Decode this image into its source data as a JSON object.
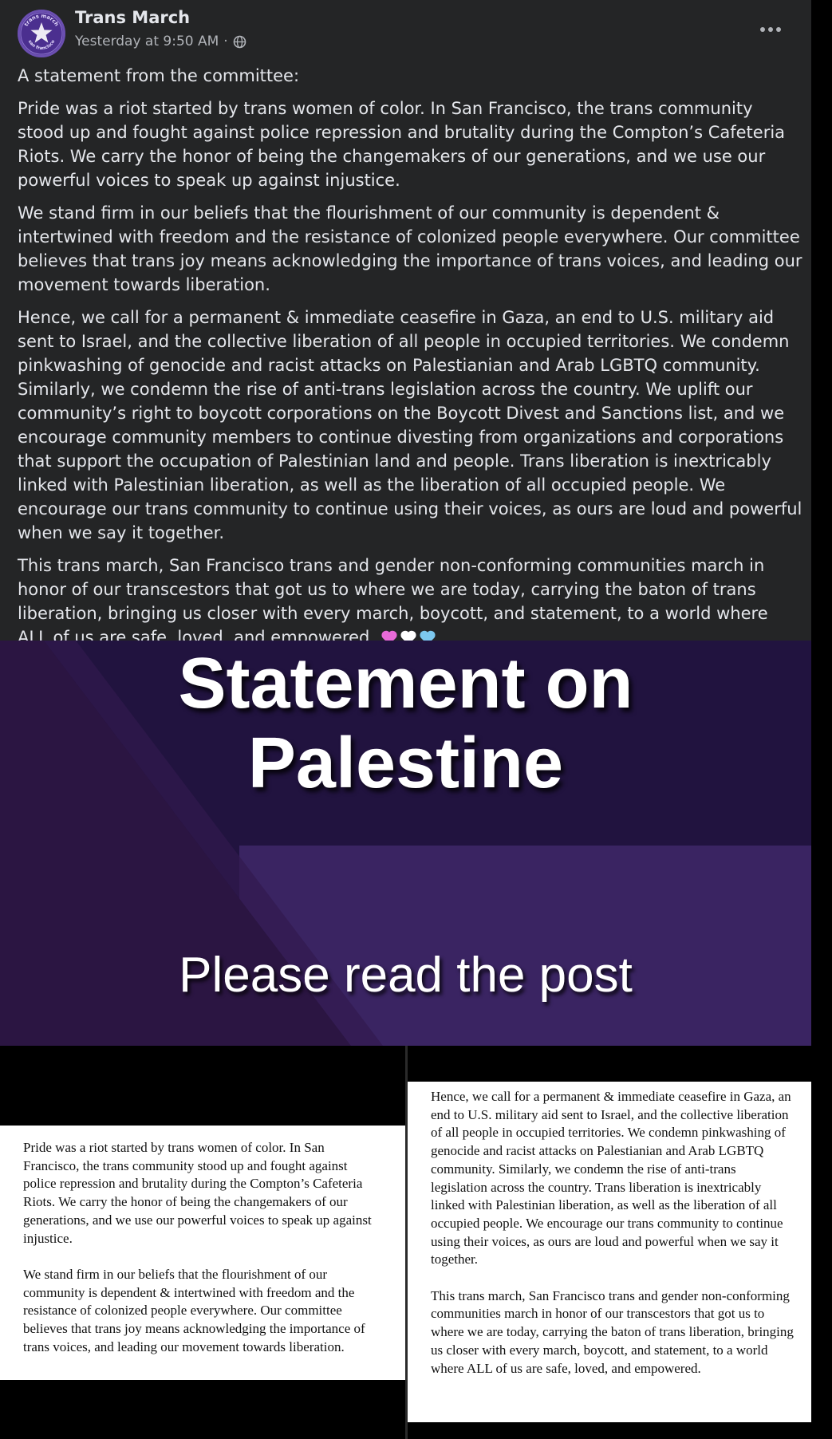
{
  "post": {
    "page_name": "Trans March",
    "timestamp": "Yesterday at 9:50 AM",
    "separator": "·",
    "privacy_icon": "globe-icon",
    "more_icon": "more-options-icon",
    "avatar": {
      "top_text": "trans march",
      "bottom_text": "san francisco",
      "icon": "star-icon"
    },
    "paragraphs": [
      "A statement from the committee:",
      "Pride was a riot started by trans women of color. In San Francisco, the trans community stood up and fought against police repression and brutality during the Compton’s Cafeteria Riots. We carry the honor of being the changemakers of our generations, and we use our powerful voices to speak up against injustice.",
      "We stand firm in our beliefs that the flourishment of our community is dependent &  intertwined with freedom and the resistance of colonized people everywhere. Our committee believes that trans joy means acknowledging the importance of trans voices, and leading our movement towards liberation.",
      "Hence, we call for a permanent & immediate ceasefire in Gaza, an end to U.S. military aid sent to Israel, and the collective liberation of all people in occupied territories. We condemn pinkwashing of genocide and racist attacks on Palestianian and Arab LGBTQ community. Similarly, we condemn the rise of anti-trans legislation across the country. We uplift our community’s right to boycott corporations on the Boycott Divest and Sanctions list, and we encourage community members to continue divesting from organizations and corporations that support the occupation of Palestinian land and people. Trans liberation is inextricably linked with Palestinian liberation, as well as the liberation of all occupied people. We encourage our trans community to continue using their voices, as ours are loud and powerful when we say it together.",
      "This trans march, San Francisco trans and gender non-conforming communities march in honor of our transcestors that got us to where we are today, carrying the baton of trans liberation, bringing us closer with every march, boycott, and statement, to a world where ALL of us are safe, loved, and empowered."
    ],
    "hearts": [
      {
        "icon": "pink-heart-icon",
        "color": "#e86ad6"
      },
      {
        "icon": "white-heart-icon",
        "color": "#ffffff"
      },
      {
        "icon": "light-blue-heart-icon",
        "color": "#7cc8ee"
      }
    ]
  },
  "banner": {
    "title_line1": "Statement on",
    "title_line2": "Palestine",
    "subtitle": "Please read the post",
    "colors": {
      "dark": "#21133f",
      "mid": "#3a2462",
      "light": "#4b2f73",
      "left": "#2b1542"
    }
  },
  "cards": {
    "left": [
      "Pride was a riot started by trans women of color. In San Francisco, the trans community stood up and fought against police repression and brutality during the Compton’s Cafeteria Riots. We carry the honor of being the changemakers of our generations, and we use our powerful voices to speak up against injustice.",
      "We stand firm in our beliefs that the flourishment of our community is dependent &  intertwined with freedom and the resistance of colonized people everywhere. Our committee believes that trans joy means acknowledging the importance of trans voices, and leading our movement towards liberation."
    ],
    "right": [
      "Hence, we call for a permanent & immediate ceasefire in Gaza, an end to U.S. military aid sent to Israel, and the collective liberation of all people in occupied territories. We condemn pinkwashing of genocide and racist attacks on Palestianian and Arab LGBTQ community. Similarly, we condemn the rise of anti-trans legislation across the country. Trans liberation is inextricably linked with Palestinian liberation, as well as the liberation of all occupied people. We encourage our trans community to continue using their voices, as ours are loud and powerful when we say it together.",
      "This trans march, San Francisco trans and gender non-conforming communities march in honor of our transcestors that got us to where we are today, carrying the baton of trans liberation, bringing us closer with every march, boycott, and statement, to a world where ALL of us are safe, loved, and empowered."
    ]
  }
}
